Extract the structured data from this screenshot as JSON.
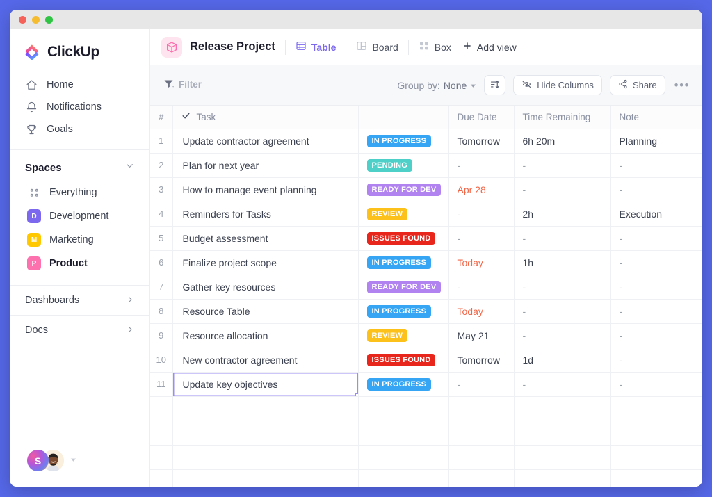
{
  "window": {
    "traffic_lights": [
      "close",
      "minimize",
      "maximize"
    ]
  },
  "sidebar": {
    "brand": "ClickUp",
    "nav": [
      {
        "label": "Home",
        "icon": "home-icon"
      },
      {
        "label": "Notifications",
        "icon": "bell-icon"
      },
      {
        "label": "Goals",
        "icon": "trophy-icon"
      }
    ],
    "spaces_header": "Spaces",
    "spaces": [
      {
        "label": "Everything",
        "icon": "grid-dots-icon",
        "initial": "",
        "color": "",
        "active": false
      },
      {
        "label": "Development",
        "icon": "space-avatar",
        "initial": "D",
        "color": "#7b68ee",
        "active": false
      },
      {
        "label": "Marketing",
        "icon": "space-avatar",
        "initial": "M",
        "color": "#ffc800",
        "active": false
      },
      {
        "label": "Product",
        "icon": "space-avatar",
        "initial": "P",
        "color": "#fd71af",
        "active": true
      }
    ],
    "sections": [
      {
        "label": "Dashboards",
        "icon": "chevron-right-icon"
      },
      {
        "label": "Docs",
        "icon": "chevron-right-icon"
      }
    ],
    "footer": {
      "avatar_initial": "S",
      "caret": "caret-down-icon"
    }
  },
  "header": {
    "project_icon": "cube-icon",
    "project_title": "Release Project",
    "views": [
      {
        "label": "Table",
        "icon": "table-icon",
        "active": true
      },
      {
        "label": "Board",
        "icon": "board-icon",
        "active": false
      },
      {
        "label": "Box",
        "icon": "box-icon",
        "active": false
      }
    ],
    "add_view": "Add view",
    "add_view_icon": "plus-icon"
  },
  "toolbar": {
    "filter_label": "Filter",
    "filter_icon": "funnel-icon",
    "group_by_prefix": "Group by:",
    "group_by_value": "None",
    "sort_icon": "sort-icon",
    "hide_columns": "Hide Columns",
    "hide_columns_icon": "eye-off-icon",
    "share": "Share",
    "share_icon": "share-icon",
    "more_icon": "ellipsis-icon",
    "accent": "#7b68ee"
  },
  "table": {
    "columns": [
      {
        "key": "num",
        "label": "#"
      },
      {
        "key": "task",
        "label": "Task",
        "icon": "check-icon"
      },
      {
        "key": "status",
        "label": ""
      },
      {
        "key": "due",
        "label": "Due Date"
      },
      {
        "key": "time",
        "label": "Time Remaining"
      },
      {
        "key": "note",
        "label": "Note"
      }
    ],
    "status_colors": {
      "IN PROGRESS": "#36a6f4",
      "PENDING": "#4ed0c8",
      "READY FOR DEV": "#b183f0",
      "REVIEW": "#fcc11b",
      "ISSUES FOUND": "#e8261c"
    },
    "rows": [
      {
        "num": "1",
        "task": "Update contractor agreement",
        "status": "IN PROGRESS",
        "due": "Tomorrow",
        "due_overdue": false,
        "time": "6h 20m",
        "note": "Planning"
      },
      {
        "num": "2",
        "task": "Plan for next year",
        "status": "PENDING",
        "due": "-",
        "due_overdue": false,
        "time": "-",
        "note": "-"
      },
      {
        "num": "3",
        "task": "How to manage event planning",
        "status": "READY FOR DEV",
        "due": "Apr 28",
        "due_overdue": true,
        "time": "-",
        "note": "-"
      },
      {
        "num": "4",
        "task": "Reminders for Tasks",
        "status": "REVIEW",
        "due": "-",
        "due_overdue": false,
        "time": "2h",
        "note": "Execution"
      },
      {
        "num": "5",
        "task": "Budget assessment",
        "status": "ISSUES FOUND",
        "due": "-",
        "due_overdue": false,
        "time": "-",
        "note": "-"
      },
      {
        "num": "6",
        "task": "Finalize project scope",
        "status": "IN PROGRESS",
        "due": "Today",
        "due_overdue": true,
        "time": "1h",
        "note": "-"
      },
      {
        "num": "7",
        "task": "Gather key resources",
        "status": "READY FOR DEV",
        "due": "-",
        "due_overdue": false,
        "time": "-",
        "note": "-"
      },
      {
        "num": "8",
        "task": "Resource Table",
        "status": "IN PROGRESS",
        "due": "Today",
        "due_overdue": true,
        "time": "-",
        "note": "-"
      },
      {
        "num": "9",
        "task": "Resource allocation",
        "status": "REVIEW",
        "due": "May 21",
        "due_overdue": false,
        "time": "-",
        "note": "-"
      },
      {
        "num": "10",
        "task": "New contractor agreement",
        "status": "ISSUES FOUND",
        "due": "Tomorrow",
        "due_overdue": false,
        "time": "1d",
        "note": "-"
      },
      {
        "num": "11",
        "task": "Update key objectives",
        "status": "IN PROGRESS",
        "due": "-",
        "due_overdue": false,
        "time": "-",
        "note": "-",
        "selected": true
      }
    ]
  }
}
